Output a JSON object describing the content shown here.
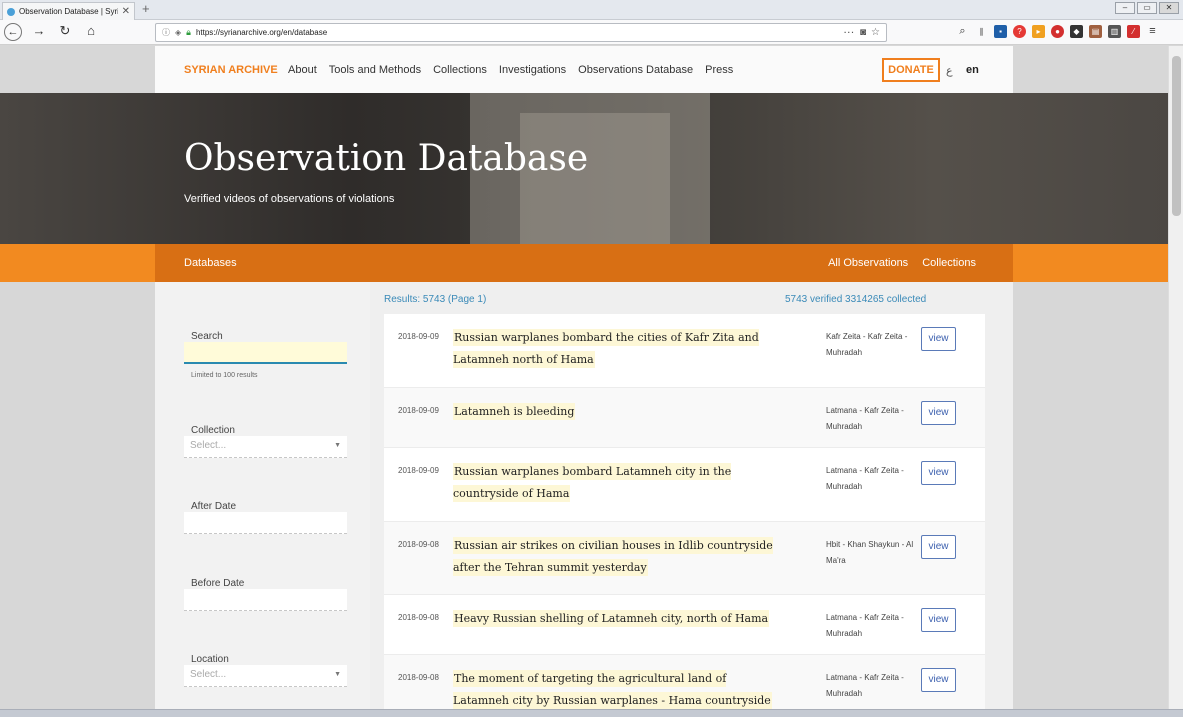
{
  "browser": {
    "tab_title": "Observation Database | Syrian A",
    "url": "https://syrianarchive.org/en/database"
  },
  "site": {
    "logo": "SYRIAN ARCHIVE",
    "nav": [
      "About",
      "Tools and Methods",
      "Collections",
      "Investigations",
      "Observations Database",
      "Press"
    ],
    "donate": "DONATE",
    "lang_ar": "ع",
    "lang_en": "en"
  },
  "hero": {
    "title": "Observation Database",
    "subtitle": "Verified videos of observations of violations"
  },
  "subnav": {
    "databases": "Databases",
    "all_observations": "All Observations",
    "collections": "Collections"
  },
  "filters": {
    "search_label": "Search",
    "search_value": "",
    "search_hint": "Limited to 100 results",
    "collection_label": "Collection",
    "collection_placeholder": "Select...",
    "after_date_label": "After Date",
    "before_date_label": "Before Date",
    "location_label": "Location",
    "location_placeholder": "Select..."
  },
  "summary": {
    "results": "Results: 5743 (Page 1)",
    "verified": "5743 verified 3314265 collected"
  },
  "results": [
    {
      "date": "2018-09-09",
      "title": "Russian warplanes bombard the cities of Kafr Zita and Latamneh north of Hama",
      "location": "Kafr Zeita - Kafr Zeita - Muhradah",
      "action": "view"
    },
    {
      "date": "2018-09-09",
      "title": "Latamneh is bleeding",
      "location": "Latmana - Kafr Zeita - Muhradah",
      "action": "view"
    },
    {
      "date": "2018-09-09",
      "title": "Russian warplanes bombard Latamneh city in the countryside of Hama",
      "location": "Latmana - Kafr Zeita - Muhradah",
      "action": "view"
    },
    {
      "date": "2018-09-08",
      "title": "Russian air strikes on civilian houses in Idlib countryside after the Tehran summit yesterday",
      "location": "Hbit - Khan Shaykun - Al Ma'ra",
      "action": "view"
    },
    {
      "date": "2018-09-08",
      "title": "Heavy Russian shelling of Latamneh city, north of Hama",
      "location": "Latmana - Kafr Zeita - Muhradah",
      "action": "view"
    },
    {
      "date": "2018-09-08",
      "title": "The moment of targeting the agricultural land of Latamneh city by Russian warplanes - Hama countryside",
      "location": "Latmana - Kafr Zeita - Muhradah",
      "action": "view"
    }
  ]
}
